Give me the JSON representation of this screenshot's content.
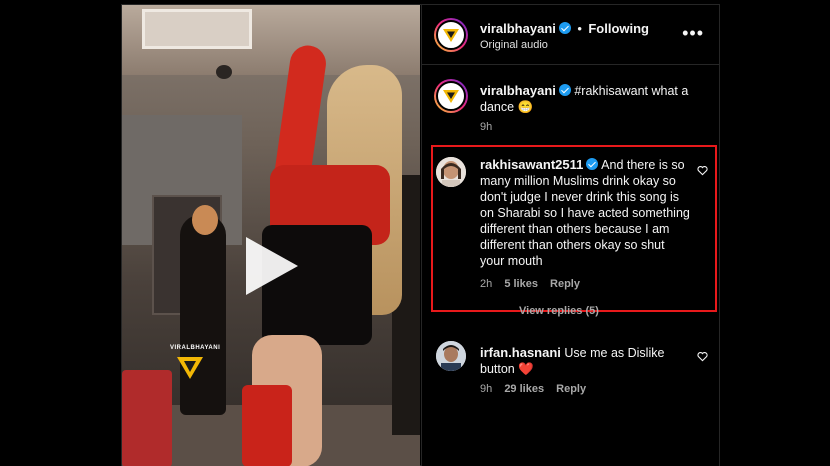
{
  "post": {
    "username": "viralbhayani",
    "follow_status": "Following",
    "separator": "•",
    "audio": "Original audio",
    "more_label": "•••"
  },
  "video": {
    "watermark_text": "VIRALBHAYANI"
  },
  "caption": {
    "username": "viralbhayani",
    "text": "#rakhisawant what a dance 😁",
    "time": "9h"
  },
  "comments": [
    {
      "username": "rakhisawant2511",
      "text": "And there is so many million Muslims drink okay so don't judge I never drink this song is on Sharabi so I have acted something different than others because I am different than others okay so shut your mouth",
      "time": "2h",
      "likes": "5 likes",
      "reply": "Reply",
      "view_replies": "View replies (5)"
    },
    {
      "username": "irfan.hasnani",
      "text": "Use me as Dislike button ❤️",
      "time": "9h",
      "likes": "29 likes",
      "reply": "Reply"
    }
  ],
  "colors": {
    "highlight": "#e8191b",
    "verified": "#1d9bf0",
    "background": "#000000"
  },
  "icons": [
    "play-icon",
    "verified-icon",
    "more-icon",
    "heart-icon",
    "viral-logo-icon"
  ]
}
